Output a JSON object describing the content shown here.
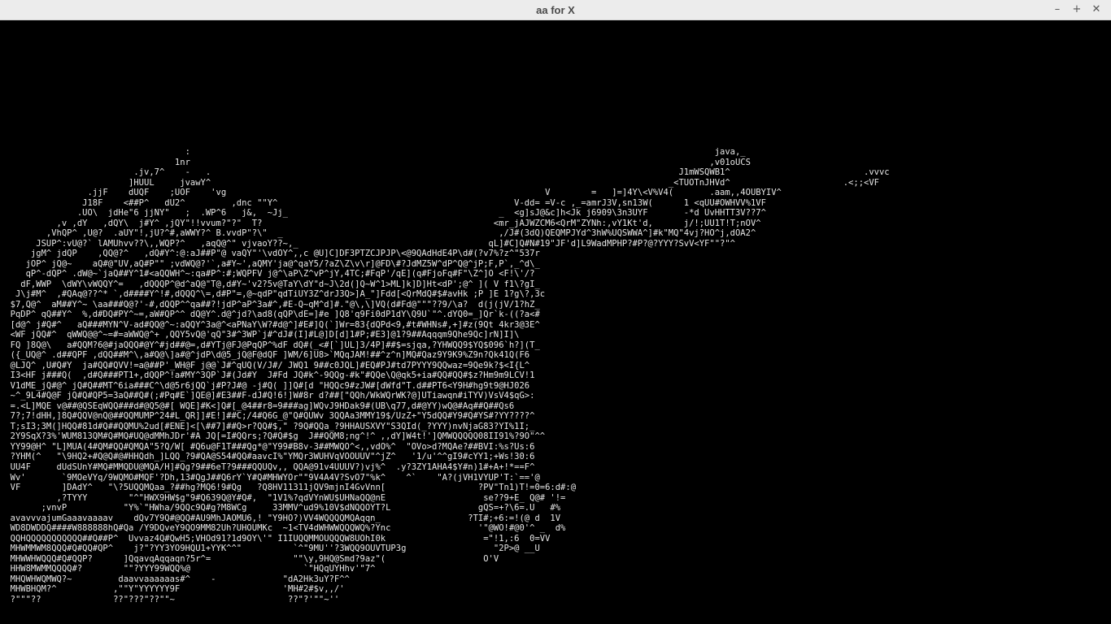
{
  "window": {
    "title": "aa for X",
    "controls": {
      "minimize": "–",
      "maximize": "+",
      "close": "✕"
    }
  },
  "ascii_art": [
    "                                    :                                                                                                      java,_",
    "                                  1nr                                                                                                     ,v01oUCS",
    "                          .jv,7^    -   .                                                                                           J1mWSQWB1^                          .vvvc",
    "                         ]HUUL     jvawY^                                                                                         _<TUOTnJHVd^                      .<;;<VF",
    "                 .jjF    dUQF    ;UOF    'vg                                                              V        =   ]=]4Y\\<V%V4(       .aam,,4OUBYIV^",
    "                J18F    <##P^   dU2^         ,dnc \"\"Y^                                              V-dd= =V-c ,_=amrJ3V,sn13W(      1 <qUU#OWHVV%1VF",
    "               .UO\\  jdHe\"6 jjNY\"   ;  .WP^6   j&,  ~Jj_                                         _  <g]sJ@&c]h<Jk j6909\\3n3UYF       -*d UvHHTT3V??7^",
    "           ,v ,dY   ,dQY\\  j#Y^ ,jQY\"!!vvum?\"?\"  T?                                             <mr_jAJWZCM6<QrM\"ZYNh:,vY1Kt'd,      j/!;UU1T!T;nOV^",
    "         ,VhQP^ ,U@?  .aUY\"!,jU?^#,aWWY?^ B.vvdP\"?\\\"  _                                          ,/J#(3dQ)QEQMPJYd^3hW%UQSWWA^]#k\"MQ\"4vj?HO^j,dOA2^",
    "       JSUP^:vU@?` lAMUhvv??\\,,WQP?^   ,aqQ@^\" vjvaoY??~,_                                     qL]#C]Q#N#19\"JF'd]L9WadMPHP?#P?@?YYY?SvV<YF\"\"?\"^",
    "      jgM^ jdQP    ,QQ@?^   ,dQ#Y^:@:aJ##P\"@ vaQY\"'\\vdOY^,,c @U]C]DF3PTZCJPJP\\<@9QAdHdE4P\\d#(?v7%?z^\"537r",
    "     jOP^ jQ@~    aQ#@\"UV,aQ#P\"\" ;vdWQ@?'`,a#Y~',aQMY'ja@^qaY5/?aZ\\Z\\v\\r]@FD\\#?JdMZ5W^dP^Q@^jP;F,P`,_^d\\_",
    "     qP^-dQP^ .dW@~`jaQ##Y^1#<aQQWH^~:qa#P^:#;WQPFV j@^\\aP\\Z^vP^jY,4TC;#FqP'/qE](q#FjoFq#F\"\\Z^]O <F!\\'/?",
    "    dF,WWP  \\dWY\\vWQQY^=   ,dQQQP^@d^aQ@\"T@,d#Y~'v2?5v@TaY\\dY\"d~J\\2d(]Q~W^1>ML]k]D]Ht<dP';@^ ]( V f1\\?gI_",
    "   J\\j#M^  ,#QAq@??^* `,d####Y^!#,dQQQ^\\=,d#P\"=,@~qdP\"qdTiUY3Z^drJ3Q>]A_\"]Fdd[<QrMdQ#$#avHk ;P ]E 1?g\\?,3c",
    "  $7,Q@^  aM##Y^~ \\aa###Q@?'-#,dQQP^^qa##?!jdP^aP^3a#^,#E-Q~qM^d]#.\"@\\,\\]VQ(d#Fd@\"\"\"??9/\\a?  d(j(jV/1?hZ_",
    "  PqDP^ qQ##Y^  %,d#DQ#PY^~=,aW#QP^^ dQ@Y^.d@^jd?\\ad8(qQP\\dE=]#e ]Q8'q9Fi0dP1dY\\Q9U`\"^.dYQ0=_]Qr`k-((?a<#",
    "  [d@^ j#Q#^   aQ###MYN^V-ad#QQ@^~:aQQY^3a@^<aPNaY\\W?#d@^]#E#]Q(`]Wr=83{dQPd<9,#t#WHNs#,+]#z(9Qt 4kr3@3E^",
    "  <WF jQQ#^  qWWQ@@^~=#=aWWQ@^+ ,QQY5vQ@'qQ\"3#^3WP`j#^dJ#(I]#L@]D[d]1#P;#E3]@1?9##Aqqqm9Qhe9Qc]rN]I]\\",
    "  FQ ]8Q@\\   a#QQM?6@#jaQQQ#@Y^#jd##@=,d#YTj@FJ@PqQP^%dF dQ#(_<#[`]UL]3/4P]##$=sjqa,?YHWQQ9$YQ$096`h?](T_",
    "  ({_UQ@^ .d##QPF ,dQQ##M^\\,a#Q@\\]a#@^jdP\\d@5_jQ@F@dQF ]WM/6]U8>`MQqJAM!##^z^n]MQ#Qaz9Y9K9%Z9n?Qk41Q(F6",
    "  @LJQ^ ,U#Q#Y  ja#QQ#QVV!=a@##P'_WH@F j@@`J#^qUQ(V/J#/ JWQ1 9##c0JQL]#EQ#PJ#td7PYYY9QQwaz=9Qe9k?$<I{L^",
    "  I3<HF j###Q(  ,d#Q###PT1+,dQQP^!a#MY^3QP`J#(Jd#Y  J#Fd JQ#k^-9QQg-#k\"#QQe\\Q@qk5+ia#QQ#QQ#$z?Hm9m9LCV!1",
    "  V1dME_jQ#@^ jQ#Q##MT^6ia###C^\\d@5r6jQQ`j#P?J#@ -j#Q( ]]Q#[d \"HQQc9#zJW#[dWfd\"T.d##PT6<Y9H#hg9t9@HJ026",
    "  ~^_9L4#Q@F jQ#Q#QP5=3aQ##Q#(;#Pq#E`]QE@]#E3##F-dJ#Q!6!]W#8r d?##[\"QQh/WkWQrWK?@]UTiawqn#iTYV)VsV4$qG>:",
    "  =.<L]MQE v@##@QSEqWQQ###d#@Q5@#[ WQE]#K<]Q#[_@4##r8=9###ag]WQvJ9HDak9#(UB\\q77,d#@YY)wQ@#Aq##Q##Qs6",
    "  7?;7!dHH,]8Q#QQV@nQ@##QQMUMP^24#L_QR]]#E!]##C;/4#Q6G_@\"Q#QUWv 3QQAa3MMY19$/UzZ+\"Y5dQQ#Y9#Q#YS#?YY????^",
    "  T;sI3;3M(]HQQ#81d#Q##QQMU%2ud[#ENE]<[\\##7]##Q>r?QQ#$,\" ?9Q#QQa_?9HHAUSXVY\"S3QId(_?YYY)nvNjaG83?YI%1I;_",
    "  2Y9SqX?3%'WUM813QM#Q#MQ#UQ@dMMhJDr'#A JQ[=I#QQrs;?Q#Q#$g  J##QQM8;ng^!^ ,,dY]W4t!']QMWQQQQQ08II91%?9O\"^^",
    "  YY99@H^ \"L]MUA(4#QM#QQ#QMQA\"5?Q/W[ #Q6u@F1T###Qg*@\"Y99#B8v-3##MWQO^<,,vdO%^  \"OVo>d?MQAe?##BVI:%s?Us:6",
    "  ?YHM(^   \"\\9HQ2+#Q@Q#@#HHQdh_]LQQ_?9#QA@S54#QQ#aavcI%\"YMQr3WUHVqVOOUUV\"^jZ^   '1/u'^^gI9#cYY1;+Ws!30:6",
    "  UU4F     dUdSUnY#MQ#MMQDU@MQA/H]#Qg?9##6eT?9###QQUQv,, QQA@91v4UUUV?)vj%^  .y?3ZY1AHA4$Y#n)1#+A+!*==F^",
    "  Wv'       `9MOeVYq/9WQMO#MQF'?Dh,13#QgJ##Q6rY`Y#Q#MHWYOr\"\"9V4A4V?SvO7\"%k^    ^`    \"A?(jVH1VYUP'T:`=='@",
    "  VF        ]DAdY^   \"\\?5UQQMQaa_?##hg?MQ6!9#Qg   ?Q8HV11311jQV9mjnI4GvVnn[                  ?PV\"Tn1)T!=0=6:d#:@",
    "           ,?TYYY        \"^\"HWX9HW$g\"9#Q639Q@Y#Q#,  \"1V1%?qdVYnWU$UHNaQQ@nE                   se??9+E_ Q@# '!=",
    "        ;vnvP           \"Y%`\"HWha/9QQc9Q#g?M8WCg     33MMV^ud9%10V$dNQQOYT?L                 gQS=+?\\6=.U   #%",
    "  avavvvajumGaaavaaaav    dQv7Y9Q#@QQ#AU9MhJAOMU6,! \"Y9HO?)VV4WQQQQMQAqqn_                 ?TI#;+6:=!(@ d  1V",
    "  WD8DWDDQ####W888888hQ#Qa /Y9DQveY9QO9MM82Uh?UHOUMKc  ~1<TV4dWHWWQQQWQ%?Ync                 '\"@WO!#@0'^ _  d%",
    "  QQHQQQQQQQQQQQ##Q##P^  Uvvaz4Q#QwH5;VHOd91?1d9OY\\'\" I1IUQQMMOUQQQW8UOhI0k                   =\"!1,:6  0=VV",
    "  MHWMMWM8QQQ#Q#QQ#QP^    j?\"?YY3YO9HQU1+YYK^^\"          `^\"9MU''?3WQQ9OUVTUP3g                 \"2P>@ __U",
    "  MHWWHWQQQ#Q#QQP?      ]QqavqAqqaqn?5r^=                \"\"\\y,9HQ@Smd?9az\"(                   O'V",
    "  HHW8MWMMQQQQ#?        \"\"?YYY99WQQ%@                      `\"HQqUYHhv'\"7^",
    "  MHQWHWQMWQ?~         daavvaaaaaas#^    -             \"dA2Hk3uY?F^^",
    "  MHWBHQM?^           ,\"\"Y\"YYYYYY9F                    'MH#2#$v,,/'",
    "  ?\"\"\"??              ??\"???\"??\"\"~                      ??\"?'\"\"~''"
  ]
}
